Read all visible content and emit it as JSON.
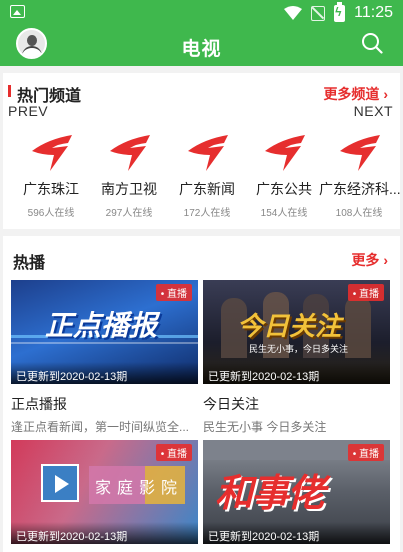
{
  "status": {
    "time": "11:25"
  },
  "header": {
    "title": "电视"
  },
  "hot_channels": {
    "title": "热门频道",
    "more": "更多频道 ›",
    "prev": "PREV",
    "next": "NEXT",
    "items": [
      {
        "name": "广东珠江",
        "count": "596人在线"
      },
      {
        "name": "南方卫视",
        "count": "297人在线"
      },
      {
        "name": "广东新闻",
        "count": "172人在线"
      },
      {
        "name": "广东公共",
        "count": "154人在线"
      },
      {
        "name": "广东经济科...",
        "count": "108人在线"
      }
    ]
  },
  "hot_broadcast": {
    "title": "热播",
    "more": "更多 ›",
    "items": [
      {
        "live": "• 直播",
        "updated": "已更新到2020-02-13期",
        "title": "正点播报",
        "desc": "逢正点看新闻，第一时间纵览全...",
        "poster": "正点播报"
      },
      {
        "live": "• 直播",
        "updated": "已更新到2020-02-13期",
        "title": "今日关注",
        "desc": "民生无小事 今日多关注",
        "poster": "今日关注",
        "poster_sub": "民生无小事，今日多关注"
      },
      {
        "live": "• 直播",
        "updated": "已更新到2020-02-13期",
        "poster": "家庭影院"
      },
      {
        "live": "• 直播",
        "updated": "已更新到2020-02-13期",
        "poster": "和事佬"
      }
    ]
  },
  "colors": {
    "brand": "#3fb84d",
    "accent": "#e62e2e"
  }
}
